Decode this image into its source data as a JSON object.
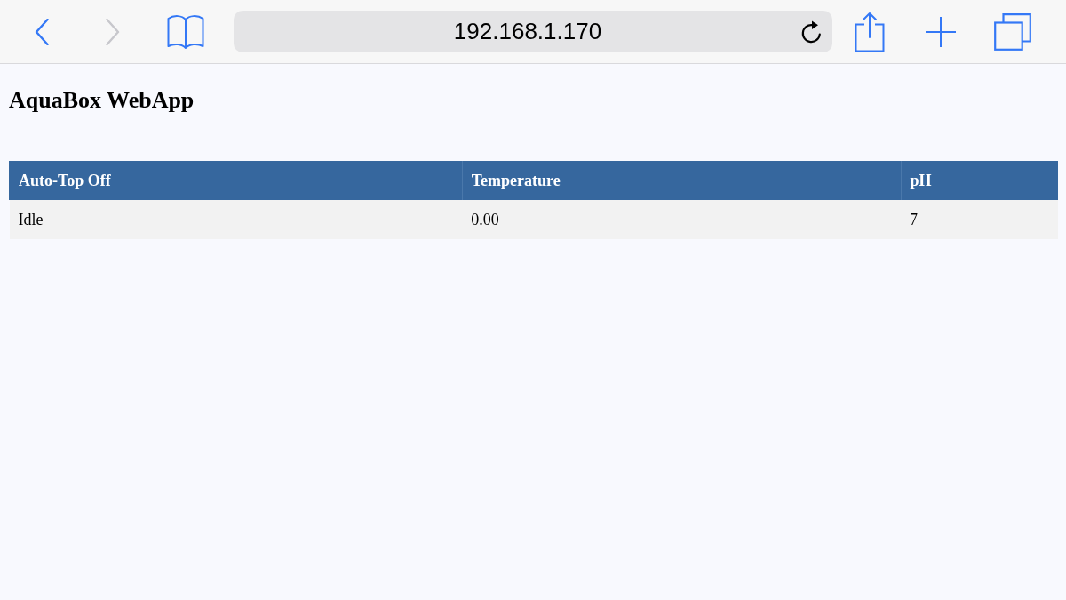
{
  "toolbar": {
    "back": {
      "disabled": false
    },
    "forward": {
      "disabled": true
    },
    "address": "192.168.1.170"
  },
  "page": {
    "title": "AquaBox WebApp",
    "table": {
      "columns": [
        "Auto-Top Off",
        "Temperature",
        "pH"
      ],
      "rows": [
        [
          "Idle",
          "0.00",
          "7"
        ]
      ]
    }
  }
}
